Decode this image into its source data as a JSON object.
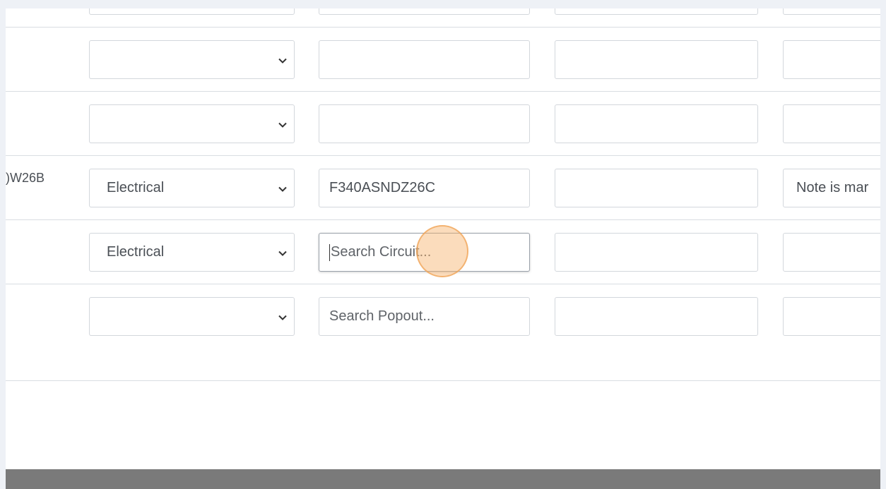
{
  "rows": [
    {
      "label": "",
      "category": "",
      "circuit": "",
      "circuit_placeholder": "",
      "col3": "",
      "note": ""
    },
    {
      "label": "",
      "category": "",
      "circuit": "",
      "circuit_placeholder": "",
      "col3": "",
      "note": ""
    },
    {
      "label": "",
      "category": "",
      "circuit": "",
      "circuit_placeholder": "",
      "col3": "",
      "note": ""
    },
    {
      "label": ")W26B",
      "category": "Electrical",
      "circuit": "F340ASNDZ26C",
      "circuit_placeholder": "",
      "col3": "",
      "note": "Note is mar"
    },
    {
      "label": "",
      "category": "Electrical",
      "circuit": "",
      "circuit_placeholder": "Search Circuit...",
      "col3": "",
      "note": ""
    },
    {
      "label": "",
      "category": "",
      "circuit": "",
      "circuit_placeholder": "Search Popout...",
      "col3": "",
      "note": ""
    }
  ],
  "icons": {
    "select_caret": "chevron-down-icon"
  },
  "colors": {
    "click_highlight": "#f6b26b",
    "footer": "#7a7a7a",
    "page_bg": "#eef1f6"
  }
}
